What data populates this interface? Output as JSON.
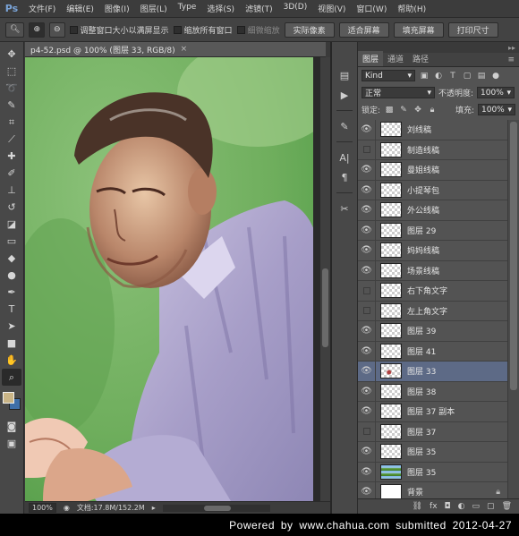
{
  "app": {
    "logo": "Ps"
  },
  "menu": [
    "文件(F)",
    "编辑(E)",
    "图像(I)",
    "图层(L)",
    "Type",
    "选择(S)",
    "滤镜(T)",
    "3D(D)",
    "视图(V)",
    "窗口(W)",
    "帮助(H)"
  ],
  "options": {
    "tool_icon": "zoom-icon",
    "resize_windows_label": "调整窗口大小以满屏显示",
    "zoom_all_windows_label": "缩放所有窗口",
    "scrubby_zoom_label": "细微缩放",
    "actual_pixels_label": "实际像素",
    "fit_screen_label": "适合屏幕",
    "fill_screen_label": "填充屏幕",
    "print_size_label": "打印尺寸"
  },
  "document": {
    "tab_title": "p4-52.psd @ 100% (图层 33, RGB/8)",
    "close_glyph": "×",
    "zoom": "100%",
    "doc_info": "文档:17.8M/152.2M"
  },
  "swatches": {
    "foreground": "#c9b486",
    "background": "#3f6fa8"
  },
  "tools": [
    "move-icon",
    "marquee-icon",
    "lasso-icon",
    "quick-select-icon",
    "crop-icon",
    "eyedropper-icon",
    "healing-icon",
    "brush-icon",
    "stamp-icon",
    "history-brush-icon",
    "eraser-icon",
    "gradient-icon",
    "blur-icon",
    "dodge-icon",
    "pen-icon",
    "type-icon",
    "path-select-icon",
    "shape-icon",
    "hand-icon",
    "zoom-icon"
  ],
  "panel": {
    "tabs": [
      "图层",
      "通道",
      "路径"
    ],
    "kind_label": "Kind",
    "blend_mode": "正常",
    "opacity_label": "不透明度:",
    "opacity_value": "100%",
    "lock_label": "锁定:",
    "fill_label": "填充:",
    "fill_value": "100%"
  },
  "layers": [
    {
      "name": "刘线稿",
      "visible": true,
      "thumb": "checker",
      "selected": false
    },
    {
      "name": "制造线稿",
      "visible": false,
      "thumb": "checker",
      "selected": false
    },
    {
      "name": "曼姐线稿",
      "visible": true,
      "thumb": "checker",
      "selected": false
    },
    {
      "name": "小提琴包",
      "visible": true,
      "thumb": "checker",
      "selected": false
    },
    {
      "name": "外公线稿",
      "visible": true,
      "thumb": "checker",
      "selected": false
    },
    {
      "name": "图层 29",
      "visible": true,
      "thumb": "checker",
      "selected": false
    },
    {
      "name": "妈妈线稿",
      "visible": true,
      "thumb": "checker",
      "selected": false
    },
    {
      "name": "场景线稿",
      "visible": true,
      "thumb": "checker",
      "selected": false
    },
    {
      "name": "右下角文字",
      "visible": false,
      "thumb": "checker",
      "selected": false
    },
    {
      "name": "左上角文字",
      "visible": false,
      "thumb": "checker",
      "selected": false
    },
    {
      "name": "图层 39",
      "visible": true,
      "thumb": "checker",
      "selected": false
    },
    {
      "name": "图层 41",
      "visible": true,
      "thumb": "checker",
      "selected": false
    },
    {
      "name": "图层 33",
      "visible": true,
      "thumb": "mark",
      "selected": true
    },
    {
      "name": "图层 38",
      "visible": true,
      "thumb": "checker",
      "selected": false
    },
    {
      "name": "图层 37 副本",
      "visible": true,
      "thumb": "checker",
      "selected": false
    },
    {
      "name": "图层 37",
      "visible": false,
      "thumb": "checker",
      "selected": false
    },
    {
      "name": "图层 35",
      "visible": true,
      "thumb": "checker",
      "selected": false
    },
    {
      "name": "图层 35",
      "visible": true,
      "thumb": "photo",
      "selected": false
    },
    {
      "name": "背景",
      "visible": true,
      "thumb": "white",
      "selected": false,
      "locked": true
    }
  ],
  "credit": "Powered by www.chahua.com submitted 2012-04-27"
}
